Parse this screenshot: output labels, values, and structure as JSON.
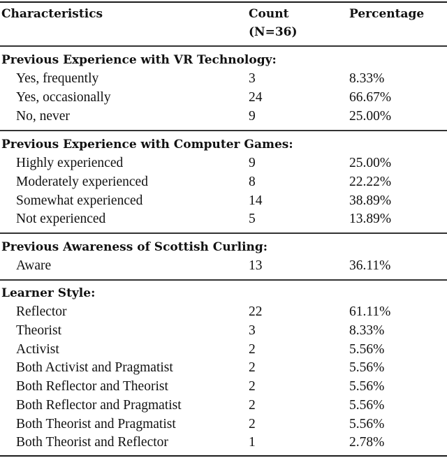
{
  "header": {
    "characteristics": "Characteristics",
    "count_line1": "Count",
    "count_line2": "(N=36)",
    "percentage": "Percentage"
  },
  "sections": [
    {
      "title": "Previous Experience with VR Technology:",
      "rows": [
        {
          "label": "Yes, frequently",
          "count": "3",
          "percentage": "8.33%"
        },
        {
          "label": "Yes, occasionally",
          "count": "24",
          "percentage": "66.67%"
        },
        {
          "label": "No, never",
          "count": "9",
          "percentage": "25.00%"
        }
      ]
    },
    {
      "title": "Previous Experience with Computer Games:",
      "rows": [
        {
          "label": "Highly experienced",
          "count": "9",
          "percentage": "25.00%"
        },
        {
          "label": "Moderately experienced",
          "count": "8",
          "percentage": "22.22%"
        },
        {
          "label": "Somewhat experienced",
          "count": "14",
          "percentage": "38.89%"
        },
        {
          "label": "Not experienced",
          "count": "5",
          "percentage": "13.89%"
        }
      ]
    },
    {
      "title": "Previous Awareness of Scottish Curling:",
      "rows": [
        {
          "label": "Aware",
          "count": "13",
          "percentage": "36.11%"
        }
      ]
    },
    {
      "title": "Learner Style:",
      "rows": [
        {
          "label": "Reflector",
          "count": "22",
          "percentage": "61.11%"
        },
        {
          "label": "Theorist",
          "count": "3",
          "percentage": "8.33%"
        },
        {
          "label": "Activist",
          "count": "2",
          "percentage": "5.56%"
        },
        {
          "label": "Both Activist and Pragmatist",
          "count": "2",
          "percentage": "5.56%"
        },
        {
          "label": "Both Reflector and Theorist",
          "count": "2",
          "percentage": "5.56%"
        },
        {
          "label": "Both Reflector and Pragmatist",
          "count": "2",
          "percentage": "5.56%"
        },
        {
          "label": "Both Theorist and Pragmatist",
          "count": "2",
          "percentage": "5.56%"
        },
        {
          "label": "Both Theorist and Reflector",
          "count": "1",
          "percentage": "2.78%"
        }
      ]
    }
  ]
}
